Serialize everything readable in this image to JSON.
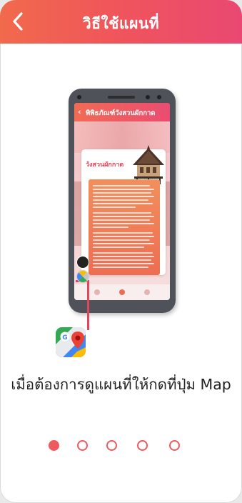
{
  "header": {
    "title": "วิธีใช้แผนที่",
    "back_icon": "chevron-left-icon"
  },
  "illustration": {
    "screen_title": "พิพิธภัณฑ์วังสวนผักกาด",
    "card_title": "วังสวนผักกาด",
    "map_icon": "google-maps-icon"
  },
  "instruction": "เมื่อต้องการดูแผนที่ให้กดที่ปุ่ม Map",
  "pagination": {
    "total": 5,
    "active_index": 0
  },
  "colors": {
    "header_start": "#f16a4c",
    "header_end": "#ea4872",
    "accent": "#ee5a5e",
    "text": "#222222"
  }
}
